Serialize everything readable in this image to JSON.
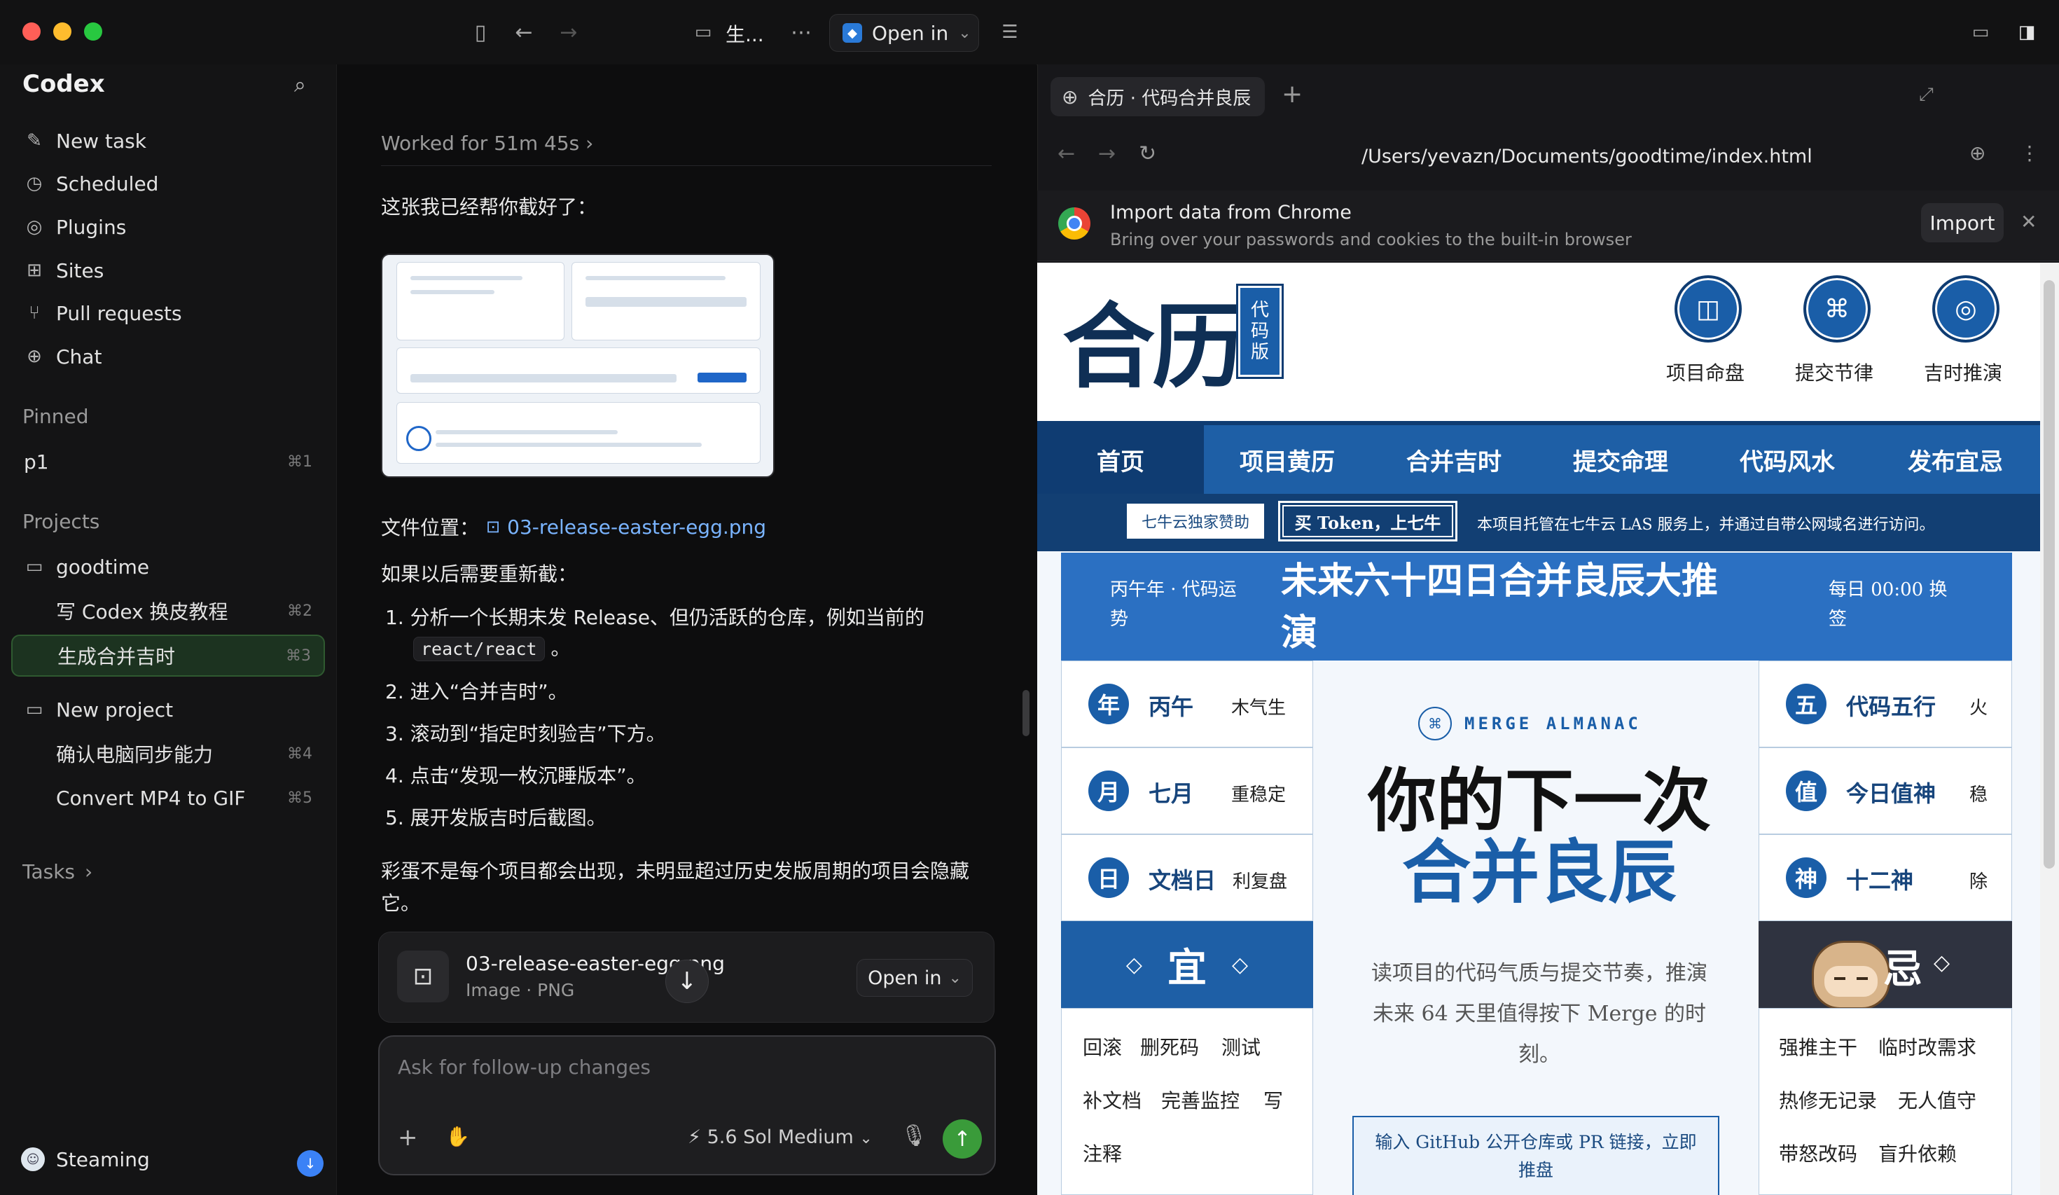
{
  "titlebar": {
    "folder_title": "生...",
    "open_in": "Open in"
  },
  "sidebar": {
    "brand": "Codex",
    "actions": [
      {
        "label": "New task",
        "icon": "edit-icon"
      },
      {
        "label": "Scheduled",
        "icon": "clock-icon"
      },
      {
        "label": "Plugins",
        "icon": "plugin-icon"
      },
      {
        "label": "Sites",
        "icon": "grid-icon"
      },
      {
        "label": "Pull requests",
        "icon": "pull-request-icon"
      },
      {
        "label": "Chat",
        "icon": "plus-circle-icon"
      }
    ],
    "pinned_heading": "Pinned",
    "pinned": [
      {
        "label": "p1",
        "shortcut": "⌘1"
      }
    ],
    "projects_heading": "Projects",
    "project1": {
      "label": "goodtime",
      "items": [
        {
          "label": "写 Codex 换皮教程",
          "shortcut": "⌘2"
        },
        {
          "label": "生成合并吉时",
          "shortcut": "⌘3"
        }
      ]
    },
    "project2": {
      "label": "New project",
      "items": [
        {
          "label": "确认电脑同步能力",
          "shortcut": "⌘4"
        },
        {
          "label": "Convert MP4 to GIF",
          "shortcut": "⌘5"
        }
      ]
    },
    "tasks_heading": "Tasks",
    "user": "Steaming"
  },
  "chat": {
    "worked": "Worked for 51m 45s",
    "intro": "这张我已经帮你截好了：",
    "file_label": "文件位置：",
    "file_link": "03-release-easter-egg.png",
    "redo": "如果以后需要重新截：",
    "steps": [
      "分析一个长期未发 Release、但仍活跃的仓库，例如当前的",
      "进入“合并吉时”。",
      "滚动到“指定时刻验吉”下方。",
      "点击“发现一枚沉睡版本”。",
      "展开发版吉时后截图。"
    ],
    "step1_code": "react/react",
    "step1_tail": "。",
    "step_nums": [
      "1.",
      "2.",
      "3.",
      "4.",
      "5."
    ],
    "note_line1": "彩蛋不是每个项目都会出现，未明显超过历史发版周期的项目会隐藏",
    "note_line2": "它。",
    "attachment": {
      "name": "03-release-easter-egg.png",
      "type": "Image · PNG",
      "open": "Open in"
    },
    "composer": {
      "placeholder": "Ask for follow-up changes",
      "model": "5.6 Sol Medium"
    }
  },
  "browser": {
    "tab_title": "合历 · 代码合并良辰",
    "url": "/Users/yevazn/Documents/goodtime/index.html",
    "import_title": "Import data from Chrome",
    "import_sub": "Bring over your passwords and cookies to the built-in browser",
    "import_btn": "Import"
  },
  "site": {
    "logo": "合历",
    "seal": [
      "代",
      "码",
      "版"
    ],
    "header_icons": [
      {
        "label": "项目命盘",
        "glyph": "◫"
      },
      {
        "label": "提交节律",
        "glyph": "⌘"
      },
      {
        "label": "吉时推演",
        "glyph": "◎"
      }
    ],
    "nav": [
      "首页",
      "项目黄历",
      "合并吉时",
      "提交命理",
      "代码风水",
      "发布宜忌"
    ],
    "promo_badge": "七牛云独家赞助",
    "promo_token": "买 Token，上七牛",
    "promo_text": "本项目托管在七牛云 LAS 服务上，并通过自带公网域名进行访问。",
    "banner_left": [
      "丙午年 · 代码运",
      "势"
    ],
    "banner_title": [
      "未来六十四日合并良辰大推",
      "演"
    ],
    "banner_right": [
      "每日 00:00 换",
      "签"
    ],
    "left_cells": [
      {
        "badge": "年",
        "main": "丙午",
        "side": "木气生"
      },
      {
        "badge": "月",
        "main": "七月",
        "side": "重稳定"
      },
      {
        "badge": "日",
        "main": "文档日",
        "side": "利复盘"
      }
    ],
    "right_cells": [
      {
        "badge": "五",
        "main": "代码五行",
        "side": "火"
      },
      {
        "badge": "值",
        "main": "今日值神",
        "side": "稳"
      },
      {
        "badge": "神",
        "main": "十二神",
        "side": "除"
      }
    ],
    "yi": "宜",
    "yi_items": [
      "回滚",
      "删死码",
      "测试",
      "补文档",
      "完善监控",
      "写",
      "注释"
    ],
    "ji_glyph": "忌",
    "ji_items": [
      "强推主干",
      "临时改需求",
      "热修无记录",
      "无人值守",
      "带怒改码",
      "盲升依赖"
    ],
    "center_tag": "MERGE ALMANAC",
    "center_title_1": "你的下一次",
    "center_title_2": "合并良辰",
    "center_desc": [
      "读项目的代码气质与提交节奏，推演",
      "未来 64 天里值得按下 Merge 的时",
      "刻。"
    ],
    "input_hint": [
      "输入 GitHub 公开仓库或 PR 链接，立即",
      "推盘"
    ]
  }
}
